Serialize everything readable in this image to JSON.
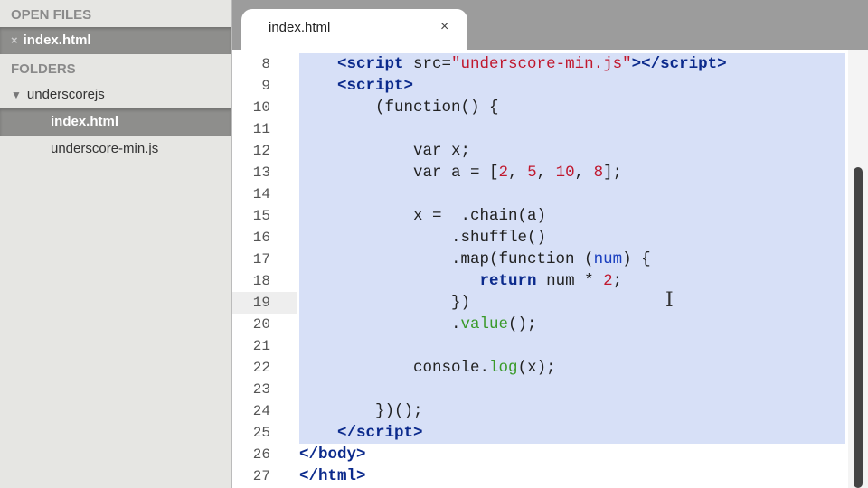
{
  "sidebar": {
    "open_files_heading": "OPEN FILES",
    "open_files": [
      {
        "close": "×",
        "label": "index.html"
      }
    ],
    "folders_heading": "FOLDERS",
    "folder": {
      "arrow": "▼",
      "label": "underscorejs"
    },
    "files": [
      "index.html",
      "underscore-min.js"
    ]
  },
  "tab": {
    "label": "index.html",
    "close": "×"
  },
  "editor": {
    "current_line": 19,
    "lines": [
      {
        "n": 8,
        "sel": true,
        "t": [
          [
            "",
            "    "
          ],
          [
            "k",
            "<script "
          ],
          [
            "",
            "src="
          ],
          [
            "s",
            "\"underscore-min.js\""
          ],
          [
            "k",
            "></script>"
          ]
        ]
      },
      {
        "n": 9,
        "sel": true,
        "t": [
          [
            "",
            "    "
          ],
          [
            "k",
            "<script>"
          ]
        ]
      },
      {
        "n": 10,
        "sel": true,
        "t": [
          [
            "",
            "        (function() {"
          ]
        ]
      },
      {
        "n": 11,
        "sel": true,
        "t": []
      },
      {
        "n": 12,
        "sel": true,
        "t": [
          [
            "",
            "            var x;"
          ]
        ]
      },
      {
        "n": 13,
        "sel": true,
        "t": [
          [
            "",
            "            var a = ["
          ],
          [
            "n",
            "2"
          ],
          [
            "",
            ", "
          ],
          [
            "n",
            "5"
          ],
          [
            "",
            ", "
          ],
          [
            "n",
            "10"
          ],
          [
            "",
            ", "
          ],
          [
            "n",
            "8"
          ],
          [
            "",
            "];"
          ]
        ]
      },
      {
        "n": 14,
        "sel": true,
        "t": []
      },
      {
        "n": 15,
        "sel": true,
        "t": [
          [
            "",
            "            x = _.chain(a)"
          ]
        ]
      },
      {
        "n": 16,
        "sel": true,
        "t": [
          [
            "",
            "                .shuffle()"
          ]
        ]
      },
      {
        "n": 17,
        "sel": true,
        "t": [
          [
            "",
            "                .map(function ("
          ],
          [
            "p",
            "num"
          ],
          [
            "",
            ") {"
          ]
        ]
      },
      {
        "n": 18,
        "sel": true,
        "t": [
          [
            "",
            "                   "
          ],
          [
            "k",
            "return"
          ],
          [
            "",
            " num * "
          ],
          [
            "n",
            "2"
          ],
          [
            "",
            ";"
          ]
        ]
      },
      {
        "n": 19,
        "sel": true,
        "t": [
          [
            "",
            "                })"
          ]
        ]
      },
      {
        "n": 20,
        "sel": true,
        "t": [
          [
            "",
            "                ."
          ],
          [
            "f",
            "value"
          ],
          [
            "",
            "();"
          ]
        ]
      },
      {
        "n": 21,
        "sel": true,
        "t": []
      },
      {
        "n": 22,
        "sel": true,
        "t": [
          [
            "",
            "            console."
          ],
          [
            "f",
            "log"
          ],
          [
            "",
            "(x);"
          ]
        ]
      },
      {
        "n": 23,
        "sel": true,
        "t": []
      },
      {
        "n": 24,
        "sel": true,
        "t": [
          [
            "",
            "        })();"
          ]
        ]
      },
      {
        "n": 25,
        "sel": true,
        "t": [
          [
            "",
            "    "
          ],
          [
            "k",
            "</script>"
          ]
        ]
      },
      {
        "n": 26,
        "sel": false,
        "t": [
          [
            "k",
            "</body>"
          ]
        ]
      },
      {
        "n": 27,
        "sel": false,
        "t": [
          [
            "k",
            "</html>"
          ]
        ]
      }
    ]
  }
}
